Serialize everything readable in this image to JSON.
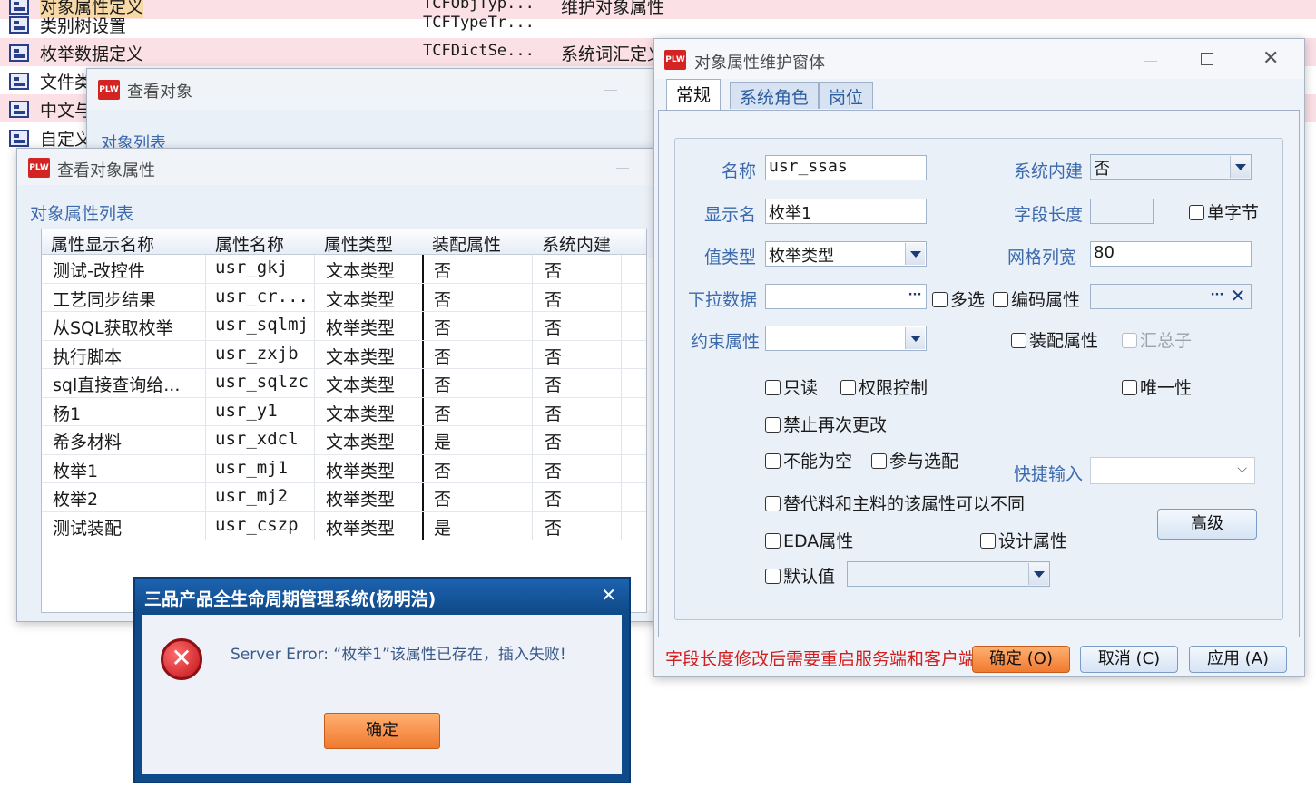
{
  "background_list": {
    "rows": [
      {
        "name": "对象属性定义",
        "col2": "TCFObjTyp...",
        "col3": "维护对象属性"
      },
      {
        "name": "类别树设置",
        "col2": "TCFTypeTr...",
        "col3": ""
      },
      {
        "name": "枚举数据定义",
        "col2": "TCFDictSe...",
        "col3": "系统词汇定义"
      },
      {
        "name": "文件类",
        "col2": "",
        "col3": ""
      },
      {
        "name": "中文与",
        "col2": "",
        "col3": ""
      },
      {
        "name": "自定义",
        "col2": "",
        "col3": ""
      }
    ]
  },
  "view_object": {
    "logo": "PLW",
    "title": "查看对象",
    "section": "对象列表"
  },
  "view_props": {
    "logo": "PLW",
    "title": "查看对象属性",
    "section": "对象属性列表",
    "columns": [
      "属性显示名称",
      "属性名称",
      "属性类型",
      "装配属性",
      "系统内建"
    ],
    "rows": [
      [
        "测试-改控件",
        "usr_gkj",
        "文本类型",
        "否",
        "否"
      ],
      [
        "工艺同步结果",
        "usr_cr...",
        "文本类型",
        "否",
        "否"
      ],
      [
        "从SQL获取枚举",
        "usr_sqlmj",
        "枚举类型",
        "否",
        "否"
      ],
      [
        "执行脚本",
        "usr_zxjb",
        "文本类型",
        "否",
        "否"
      ],
      [
        "sql直接查询给...",
        "usr_sqlzc",
        "文本类型",
        "否",
        "否"
      ],
      [
        "杨1",
        "usr_y1",
        "文本类型",
        "否",
        "否"
      ],
      [
        "希多材料",
        "usr_xdcl",
        "文本类型",
        "是",
        "否"
      ],
      [
        "枚举1",
        "usr_mj1",
        "枚举类型",
        "否",
        "否"
      ],
      [
        "枚举2",
        "usr_mj2",
        "枚举类型",
        "否",
        "否"
      ],
      [
        "测试装配",
        "usr_cszp",
        "枚举类型",
        "是",
        "否"
      ]
    ]
  },
  "prop_window": {
    "logo": "PLW",
    "title": "对象属性维护窗体",
    "tabs": [
      "常规",
      "系统角色",
      "岗位"
    ],
    "labels": {
      "name": "名称",
      "builtin": "系统内建",
      "display_name": "显示名",
      "field_length": "字段长度",
      "value_type": "值类型",
      "grid_width": "网格列宽",
      "dropdown_data": "下拉数据",
      "constraint": "约束属性",
      "quick_input": "快捷输入"
    },
    "values": {
      "name": "usr_ssas",
      "builtin": "否",
      "display_name": "枚举1",
      "field_length": "",
      "value_type": "枚举类型",
      "grid_width": "80",
      "dropdown_data": "",
      "encode_attr": "",
      "constraint": "",
      "quick_input": "",
      "default_value": ""
    },
    "checkboxes": {
      "single_byte": "单字节",
      "multi_select": "多选",
      "encode_attr": "编码属性",
      "assembly_attr": "装配属性",
      "summary_child": "汇总子",
      "readonly": "只读",
      "permission": "权限控制",
      "unique": "唯一性",
      "no_change": "禁止再次更改",
      "not_null": "不能为空",
      "join_match": "参与选配",
      "substitute": "替代料和主料的该属性可以不同",
      "eda": "EDA属性",
      "design": "设计属性",
      "default": "默认值"
    },
    "buttons": {
      "advanced": "高级",
      "ok": "确定 (O)",
      "cancel": "取消 (C)",
      "apply": "应用 (A)"
    },
    "hint": "字段长度修改后需要重启服务端和客户端"
  },
  "error_dialog": {
    "title": "三品产品全生命周期管理系统(杨明浩)",
    "message": "Server Error: “枚举1”该属性已存在，插入失败!",
    "ok": "确定"
  },
  "colors": {
    "accent": "#3c6aad",
    "error_red": "#d11f1f",
    "title_bar": "#0f4a8a",
    "orange_button": "#f07a30"
  }
}
